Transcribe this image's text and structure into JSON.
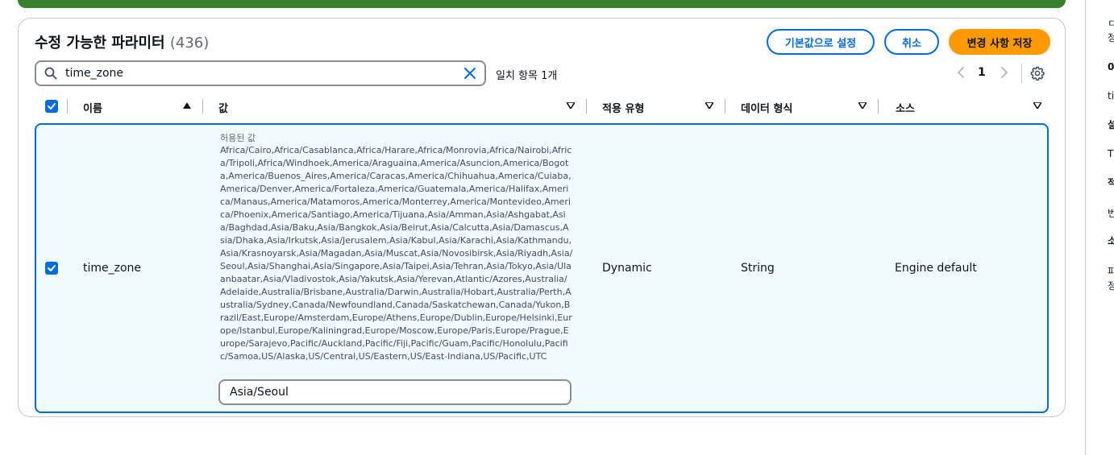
{
  "panel": {
    "title": "수정 가능한 파라미터",
    "count": "(436)",
    "reset_label": "기본값으로 설정",
    "cancel_label": "취소",
    "save_label": "변경 사항 저장"
  },
  "search": {
    "value": "time_zone",
    "match_text": "일치 항목 1개"
  },
  "pager": {
    "current": "1"
  },
  "table": {
    "headers": {
      "name": "이름",
      "value": "값",
      "apply_type": "적용 유형",
      "data_type": "데이터 형식",
      "source": "소스"
    },
    "row": {
      "name": "time_zone",
      "allowed_label": "허용된 값",
      "allowed_values": "Africa/Cairo,Africa/Casablanca,Africa/Harare,Africa/Monrovia,Africa/Nairobi,Africa/Tripoli,Africa/Windhoek,America/Araguaina,America/Asuncion,America/Bogota,America/Buenos_Aires,America/Caracas,America/Chihuahua,America/Cuiaba,America/Denver,America/Fortaleza,America/Guatemala,America/Halifax,America/Manaus,America/Matamoros,America/Monterrey,America/Montevideo,America/Phoenix,America/Santiago,America/Tijuana,Asia/Amman,Asia/Ashgabat,Asia/Baghdad,Asia/Baku,Asia/Bangkok,Asia/Beirut,Asia/Calcutta,Asia/Damascus,Asia/Dhaka,Asia/Irkutsk,Asia/Jerusalem,Asia/Kabul,Asia/Karachi,Asia/Kathmandu,Asia/Krasnoyarsk,Asia/Magadan,Asia/Muscat,Asia/Novosibirsk,Asia/Riyadh,Asia/Seoul,Asia/Shanghai,Asia/Singapore,Asia/Taipei,Asia/Tehran,Asia/Tokyo,Asia/Ulaanbaatar,Asia/Vladivostok,Asia/Yakutsk,Asia/Yerevan,Atlantic/Azores,Australia/Adelaide,Australia/Brisbane,Australia/Darwin,Australia/Hobart,Australia/Perth,Australia/Sydney,Canada/Newfoundland,Canada/Saskatchewan,Canada/Yukon,Brazil/East,Europe/Amsterdam,Europe/Athens,Europe/Dublin,Europe/Helsinki,Europe/Istanbul,Europe/Kaliningrad,Europe/Moscow,Europe/Paris,Europe/Prague,Europe/Sarajevo,Pacific/Auckland,Pacific/Fiji,Pacific/Guam,Pacific/Honolulu,Pacific/Samoa,US/Alaska,US/Central,US/Eastern,US/East-Indiana,US/Pacific,UTC",
      "value": "Asia/Seoul",
      "apply_type": "Dynamic",
      "data_type": "String",
      "source": "Engine default"
    }
  },
  "side_panel": {
    "fragments": [
      "ㄷ",
      "정",
      "0",
      "ti",
      "설",
      "T",
      "적",
      "번",
      "소",
      "파",
      "정"
    ]
  },
  "colors": {
    "primary": "#006ce0",
    "save_button": "#ff9900",
    "banner": "#37812f",
    "selected_row_bg": "#f0fbff"
  }
}
